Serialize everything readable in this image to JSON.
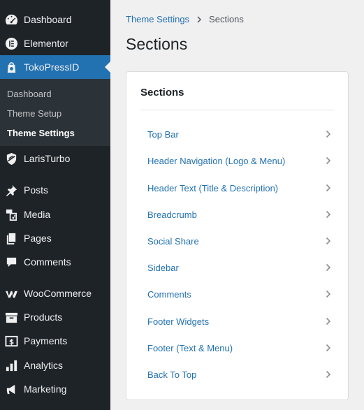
{
  "sidebar": {
    "items_top": [
      {
        "label": "Dashboard",
        "icon": "dashboard-icon"
      },
      {
        "label": "Elementor",
        "icon": "elementor-icon"
      },
      {
        "label": "TokoPressID",
        "icon": "tokopress-icon"
      }
    ],
    "submenu": [
      {
        "label": "Dashboard"
      },
      {
        "label": "Theme Setup"
      },
      {
        "label": "Theme Settings"
      }
    ],
    "items_bottom": [
      {
        "label": "LarisTurbo",
        "icon": "laristurbo-icon"
      },
      {
        "label": "Posts",
        "icon": "pin-icon"
      },
      {
        "label": "Media",
        "icon": "media-icon"
      },
      {
        "label": "Pages",
        "icon": "pages-icon"
      },
      {
        "label": "Comments",
        "icon": "comment-icon"
      },
      {
        "label": "WooCommerce",
        "icon": "woocommerce-icon"
      },
      {
        "label": "Products",
        "icon": "archive-icon"
      },
      {
        "label": "Payments",
        "icon": "payments-icon"
      },
      {
        "label": "Analytics",
        "icon": "chart-bar-icon"
      },
      {
        "label": "Marketing",
        "icon": "megaphone-icon"
      }
    ]
  },
  "breadcrumb": {
    "parent": "Theme Settings",
    "current": "Sections"
  },
  "page": {
    "title": "Sections"
  },
  "panel": {
    "title": "Sections",
    "items": [
      {
        "label": "Top Bar"
      },
      {
        "label": "Header Navigation (Logo & Menu)"
      },
      {
        "label": "Header Text (Title & Description)"
      },
      {
        "label": "Breadcrumb"
      },
      {
        "label": "Social Share"
      },
      {
        "label": "Sidebar"
      },
      {
        "label": "Comments"
      },
      {
        "label": "Footer Widgets"
      },
      {
        "label": "Footer (Text & Menu)"
      },
      {
        "label": "Back To Top"
      }
    ]
  },
  "colors": {
    "sidebar_bg": "#1d2327",
    "active_bg": "#2271b1",
    "link": "#2271b1",
    "chevron": "#8c8f94"
  }
}
